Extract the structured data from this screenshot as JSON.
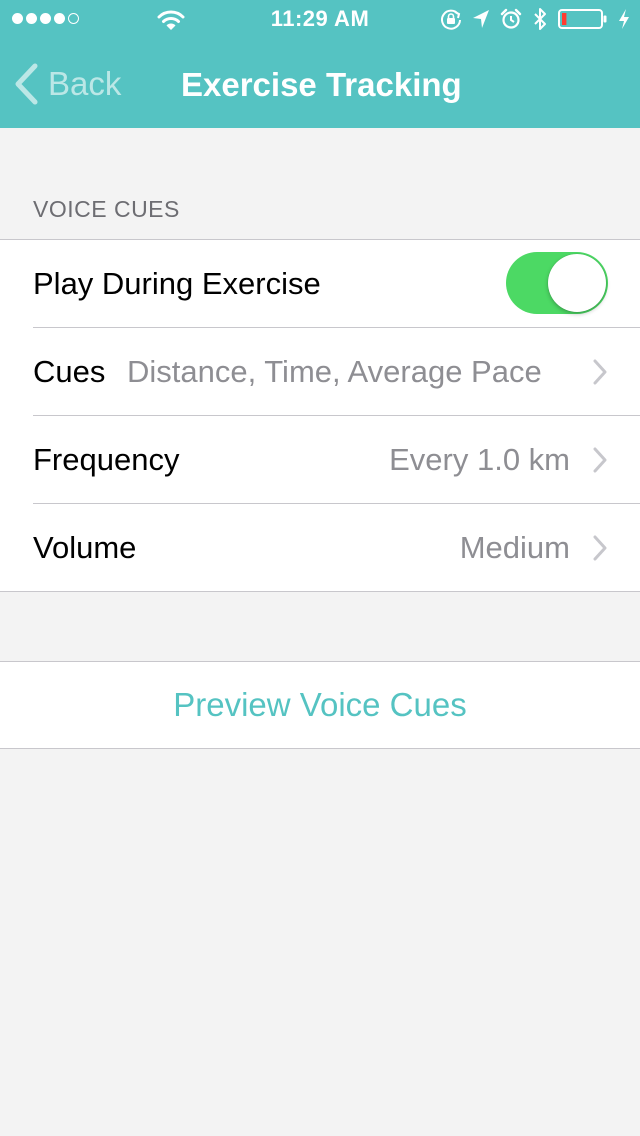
{
  "status_bar": {
    "time": "11:29 AM",
    "signal_bars_filled": 4,
    "signal_bars_total": 5,
    "battery_level_percent": 12,
    "icons": [
      "wifi-icon",
      "rotation-lock-icon",
      "location-arrow-icon",
      "alarm-icon",
      "bluetooth-icon",
      "battery-icon",
      "charging-bolt-icon"
    ]
  },
  "nav": {
    "back_label": "Back",
    "title": "Exercise Tracking"
  },
  "voice_cues": {
    "section_header": "VOICE CUES",
    "play_during_exercise": {
      "label": "Play During Exercise",
      "enabled": true
    },
    "cues": {
      "label": "Cues",
      "value": "Distance, Time, Average Pace"
    },
    "frequency": {
      "label": "Frequency",
      "value": "Every 1.0 km"
    },
    "volume": {
      "label": "Volume",
      "value": "Medium"
    }
  },
  "preview": {
    "label": "Preview Voice Cues"
  },
  "colors": {
    "accent": "#55c3c2",
    "toggle_on": "#4cd964",
    "background": "#f3f3f3",
    "battery_low": "#ff3b30"
  }
}
